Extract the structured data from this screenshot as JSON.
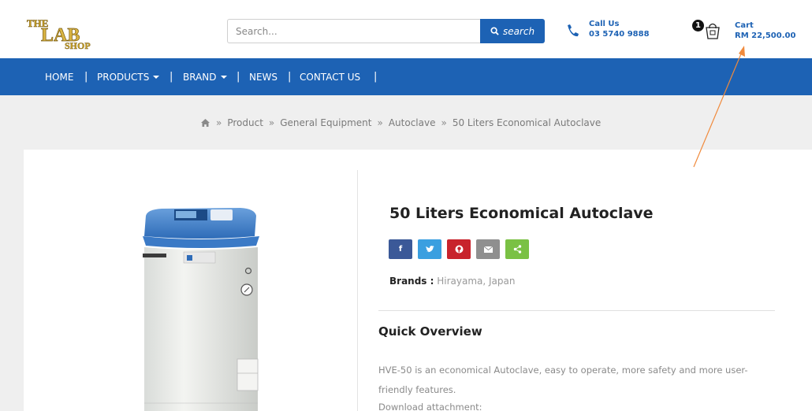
{
  "header": {
    "logo_text": "THE LAB SHOP",
    "search": {
      "placeholder": "Search...",
      "button_label": "search"
    },
    "call": {
      "label": "Call Us",
      "number": "03 5740 9888"
    },
    "cart": {
      "count": "1",
      "label": "Cart",
      "total": "RM 22,500.00"
    }
  },
  "nav": {
    "items": [
      {
        "label": "HOME"
      },
      {
        "label": "PRODUCTS"
      },
      {
        "label": "BRAND"
      },
      {
        "label": "NEWS"
      },
      {
        "label": "CONTACT US"
      }
    ],
    "separator": "|"
  },
  "breadcrumb": {
    "separator": "»",
    "items": [
      "Product",
      "General Equipment",
      "Autoclave",
      "50 Liters Economical Autoclave"
    ]
  },
  "product": {
    "title": "50 Liters Economical Autoclave",
    "share": [
      {
        "icon": "facebook-icon",
        "glyph": "f",
        "color": "#3b5998"
      },
      {
        "icon": "twitter-icon",
        "glyph": "t",
        "color": "#3a9fe0"
      },
      {
        "icon": "pinterest-icon",
        "glyph": "p",
        "color": "#c8232c"
      },
      {
        "icon": "email-icon",
        "glyph": "✉",
        "color": "#8f8f8f"
      },
      {
        "icon": "share-icon",
        "glyph": "<",
        "color": "#7ac144"
      }
    ],
    "brands_label": "Brands :",
    "brands_value": "Hirayama, Japan",
    "overview_title": "Quick Overview",
    "overview_text": "HVE-50 is an economical Autoclave, easy to operate, more safety and more user-friendly features.",
    "download_label": "Download attachment:"
  },
  "colors": {
    "brand_blue": "#1d62b4",
    "annotation_arrow": "#f08a3c"
  }
}
